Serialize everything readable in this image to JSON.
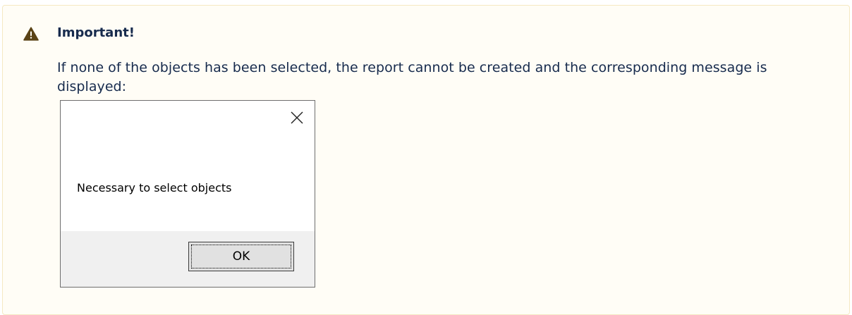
{
  "note": {
    "title": "Important!",
    "body": "If none of the objects has been selected, the report cannot be created and the corresponding message is displayed:",
    "icon": "warning-icon",
    "colors": {
      "panel_background": "#fffdf6",
      "panel_border": "#f5e9c2",
      "icon": "#5a4316",
      "text": "#172b4d"
    }
  },
  "dialog": {
    "message": "Necessary to select objects",
    "ok_label": "OK",
    "close_icon": "close-icon",
    "colors": {
      "background": "#ffffff",
      "footer": "#f0f0f0",
      "button": "#e1e1e1",
      "border": "#6e6e6e"
    }
  }
}
